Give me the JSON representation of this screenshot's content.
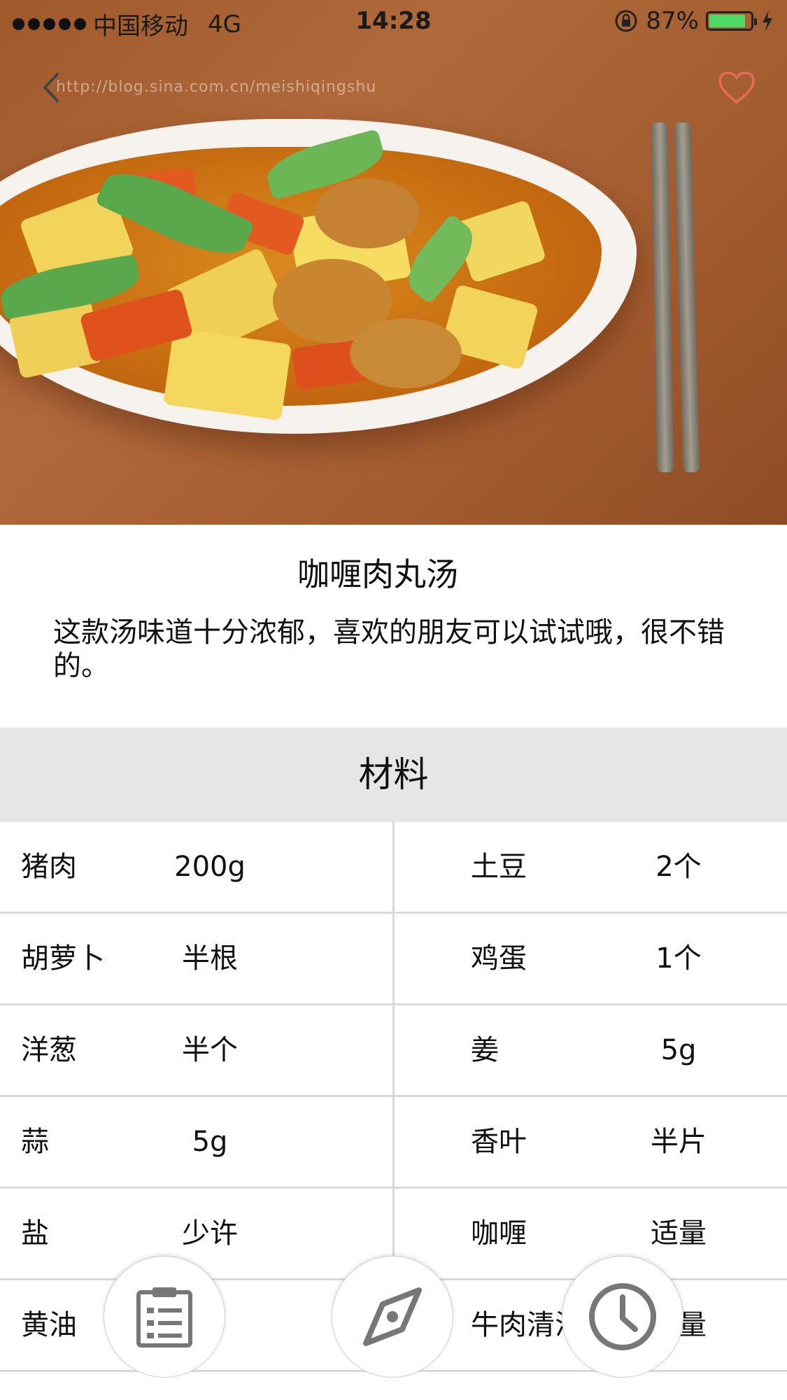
{
  "status_bar": {
    "carrier": "中国移动",
    "network": "4G",
    "time": "14:28",
    "battery": "87%"
  },
  "hero": {
    "url_watermark": "http://blog.sina.com.cn/meishiqingshu"
  },
  "recipe": {
    "title": "咖喱肉丸汤",
    "description": "这款汤味道十分浓郁，喜欢的朋友可以试试哦，很不错的。"
  },
  "materials": {
    "header": "材料",
    "rows": [
      {
        "left_name": "猪肉",
        "left_amount": "200g",
        "right_name": "土豆",
        "right_amount": "2个"
      },
      {
        "left_name": "胡萝卜",
        "left_amount": "半根",
        "right_name": "鸡蛋",
        "right_amount": "1个"
      },
      {
        "left_name": "洋葱",
        "left_amount": "半个",
        "right_name": "姜",
        "right_amount": "5g"
      },
      {
        "left_name": "蒜",
        "left_amount": "5g",
        "right_name": "香叶",
        "right_amount": "半片"
      },
      {
        "left_name": "盐",
        "left_amount": "少许",
        "right_name": "咖喱",
        "right_amount": "适量"
      },
      {
        "left_name": "黄油",
        "left_amount": "",
        "right_name": "牛肉清汤",
        "right_amount": "适量"
      }
    ]
  },
  "icons": {
    "back": "chevron-left-icon",
    "favorite": "heart-icon",
    "tab_list": "list-icon",
    "tab_explore": "compass-icon",
    "tab_history": "clock-icon"
  },
  "colors": {
    "section_header_bg": "#e6e6e6",
    "favorite_heart": "#e86b5a",
    "battery_fill": "#4cd964"
  }
}
